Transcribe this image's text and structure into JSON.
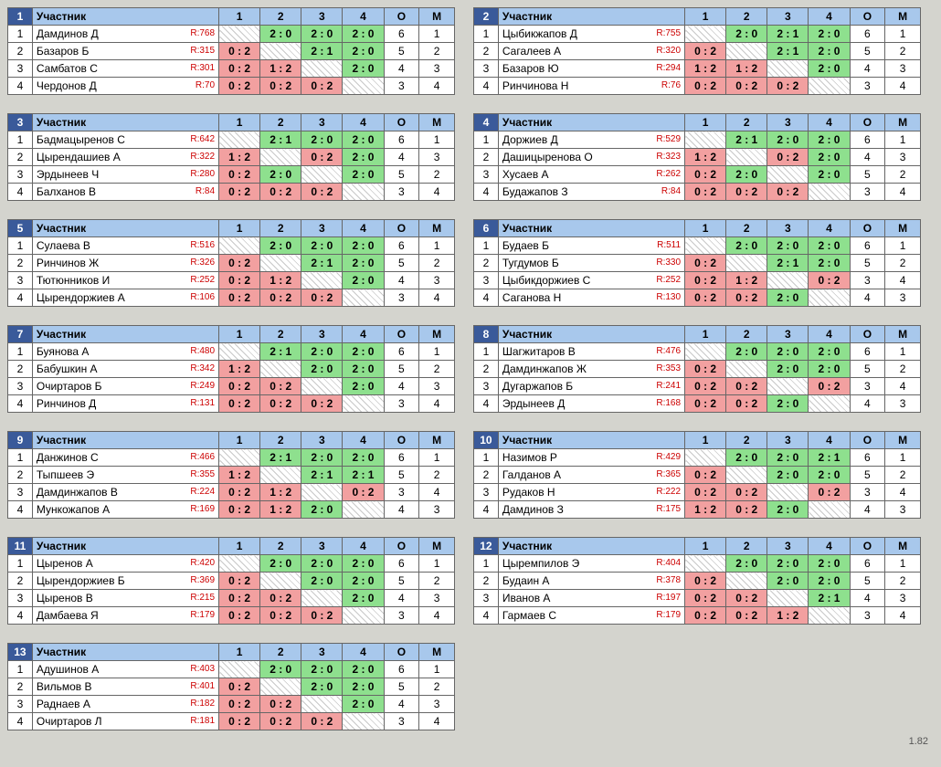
{
  "headers": {
    "player": "Участник",
    "pts": "О",
    "place": "М"
  },
  "footer_version": "1.82",
  "groups": [
    {
      "num": 1,
      "rows": [
        {
          "name": "Дамдинов Д",
          "rating": "R:768",
          "cells": [
            null,
            "2 : 0",
            "2 : 0",
            "2 : 0"
          ],
          "pts": 6,
          "place": 1
        },
        {
          "name": "Базаров Б",
          "rating": "R:315",
          "cells": [
            "0 : 2",
            null,
            "2 : 1",
            "2 : 0"
          ],
          "pts": 5,
          "place": 2
        },
        {
          "name": "Самбатов С",
          "rating": "R:301",
          "cells": [
            "0 : 2",
            "1 : 2",
            null,
            "2 : 0"
          ],
          "pts": 4,
          "place": 3
        },
        {
          "name": "Чердонов Д",
          "rating": "R:70",
          "cells": [
            "0 : 2",
            "0 : 2",
            "0 : 2",
            null
          ],
          "pts": 3,
          "place": 4
        }
      ]
    },
    {
      "num": 2,
      "rows": [
        {
          "name": "Цыбикжапов Д",
          "rating": "R:755",
          "cells": [
            null,
            "2 : 0",
            "2 : 1",
            "2 : 0"
          ],
          "pts": 6,
          "place": 1
        },
        {
          "name": "Сагалеев А",
          "rating": "R:320",
          "cells": [
            "0 : 2",
            null,
            "2 : 1",
            "2 : 0"
          ],
          "pts": 5,
          "place": 2
        },
        {
          "name": "Базаров Ю",
          "rating": "R:294",
          "cells": [
            "1 : 2",
            "1 : 2",
            null,
            "2 : 0"
          ],
          "pts": 4,
          "place": 3
        },
        {
          "name": "Ринчинова Н",
          "rating": "R:76",
          "cells": [
            "0 : 2",
            "0 : 2",
            "0 : 2",
            null
          ],
          "pts": 3,
          "place": 4
        }
      ]
    },
    {
      "num": 3,
      "rows": [
        {
          "name": "Бадмацыренов С",
          "rating": "R:642",
          "cells": [
            null,
            "2 : 1",
            "2 : 0",
            "2 : 0"
          ],
          "pts": 6,
          "place": 1
        },
        {
          "name": "Цырендашиев А",
          "rating": "R:322",
          "cells": [
            "1 : 2",
            null,
            "0 : 2",
            "2 : 0"
          ],
          "pts": 4,
          "place": 3
        },
        {
          "name": "Эрдынеев Ч",
          "rating": "R:280",
          "cells": [
            "0 : 2",
            "2 : 0",
            null,
            "2 : 0"
          ],
          "pts": 5,
          "place": 2
        },
        {
          "name": "Балханов В",
          "rating": "R:84",
          "cells": [
            "0 : 2",
            "0 : 2",
            "0 : 2",
            null
          ],
          "pts": 3,
          "place": 4
        }
      ]
    },
    {
      "num": 4,
      "rows": [
        {
          "name": "Доржиев Д",
          "rating": "R:529",
          "cells": [
            null,
            "2 : 1",
            "2 : 0",
            "2 : 0"
          ],
          "pts": 6,
          "place": 1
        },
        {
          "name": "Дашицыренова О",
          "rating": "R:323",
          "cells": [
            "1 : 2",
            null,
            "0 : 2",
            "2 : 0"
          ],
          "pts": 4,
          "place": 3
        },
        {
          "name": "Хусаев А",
          "rating": "R:262",
          "cells": [
            "0 : 2",
            "2 : 0",
            null,
            "2 : 0"
          ],
          "pts": 5,
          "place": 2
        },
        {
          "name": "Будажапов З",
          "rating": "R:84",
          "cells": [
            "0 : 2",
            "0 : 2",
            "0 : 2",
            null
          ],
          "pts": 3,
          "place": 4
        }
      ]
    },
    {
      "num": 5,
      "rows": [
        {
          "name": "Сулаева В",
          "rating": "R:516",
          "cells": [
            null,
            "2 : 0",
            "2 : 0",
            "2 : 0"
          ],
          "pts": 6,
          "place": 1
        },
        {
          "name": "Ринчинов Ж",
          "rating": "R:326",
          "cells": [
            "0 : 2",
            null,
            "2 : 1",
            "2 : 0"
          ],
          "pts": 5,
          "place": 2
        },
        {
          "name": "Тютюнников И",
          "rating": "R:252",
          "cells": [
            "0 : 2",
            "1 : 2",
            null,
            "2 : 0"
          ],
          "pts": 4,
          "place": 3
        },
        {
          "name": "Цырендоржиев А",
          "rating": "R:106",
          "cells": [
            "0 : 2",
            "0 : 2",
            "0 : 2",
            null
          ],
          "pts": 3,
          "place": 4
        }
      ]
    },
    {
      "num": 6,
      "rows": [
        {
          "name": "Будаев Б",
          "rating": "R:511",
          "cells": [
            null,
            "2 : 0",
            "2 : 0",
            "2 : 0"
          ],
          "pts": 6,
          "place": 1
        },
        {
          "name": "Тугдумов Б",
          "rating": "R:330",
          "cells": [
            "0 : 2",
            null,
            "2 : 1",
            "2 : 0"
          ],
          "pts": 5,
          "place": 2
        },
        {
          "name": "Цыбикдоржиев С",
          "rating": "R:252",
          "cells": [
            "0 : 2",
            "1 : 2",
            null,
            "0 : 2"
          ],
          "pts": 3,
          "place": 4
        },
        {
          "name": "Саганова Н",
          "rating": "R:130",
          "cells": [
            "0 : 2",
            "0 : 2",
            "2 : 0",
            null
          ],
          "pts": 4,
          "place": 3
        }
      ]
    },
    {
      "num": 7,
      "rows": [
        {
          "name": "Буянова А",
          "rating": "R:480",
          "cells": [
            null,
            "2 : 1",
            "2 : 0",
            "2 : 0"
          ],
          "pts": 6,
          "place": 1
        },
        {
          "name": "Бабушкин А",
          "rating": "R:342",
          "cells": [
            "1 : 2",
            null,
            "2 : 0",
            "2 : 0"
          ],
          "pts": 5,
          "place": 2
        },
        {
          "name": "Очиртаров Б",
          "rating": "R:249",
          "cells": [
            "0 : 2",
            "0 : 2",
            null,
            "2 : 0"
          ],
          "pts": 4,
          "place": 3
        },
        {
          "name": "Ринчинов Д",
          "rating": "R:131",
          "cells": [
            "0 : 2",
            "0 : 2",
            "0 : 2",
            null
          ],
          "pts": 3,
          "place": 4
        }
      ]
    },
    {
      "num": 8,
      "rows": [
        {
          "name": "Шагжитаров В",
          "rating": "R:476",
          "cells": [
            null,
            "2 : 0",
            "2 : 0",
            "2 : 0"
          ],
          "pts": 6,
          "place": 1
        },
        {
          "name": "Дамдинжапов Ж",
          "rating": "R:353",
          "cells": [
            "0 : 2",
            null,
            "2 : 0",
            "2 : 0"
          ],
          "pts": 5,
          "place": 2
        },
        {
          "name": "Дугаржапов Б",
          "rating": "R:241",
          "cells": [
            "0 : 2",
            "0 : 2",
            null,
            "0 : 2"
          ],
          "pts": 3,
          "place": 4
        },
        {
          "name": "Эрдынеев Д",
          "rating": "R:168",
          "cells": [
            "0 : 2",
            "0 : 2",
            "2 : 0",
            null
          ],
          "pts": 4,
          "place": 3
        }
      ]
    },
    {
      "num": 9,
      "rows": [
        {
          "name": "Данжинов С",
          "rating": "R:466",
          "cells": [
            null,
            "2 : 1",
            "2 : 0",
            "2 : 0"
          ],
          "pts": 6,
          "place": 1
        },
        {
          "name": "Тыпшеев Э",
          "rating": "R:355",
          "cells": [
            "1 : 2",
            null,
            "2 : 1",
            "2 : 1"
          ],
          "pts": 5,
          "place": 2
        },
        {
          "name": "Дамдинжапов В",
          "rating": "R:224",
          "cells": [
            "0 : 2",
            "1 : 2",
            null,
            "0 : 2"
          ],
          "pts": 3,
          "place": 4
        },
        {
          "name": "Мункожапов А",
          "rating": "R:169",
          "cells": [
            "0 : 2",
            "1 : 2",
            "2 : 0",
            null
          ],
          "pts": 4,
          "place": 3
        }
      ]
    },
    {
      "num": 10,
      "rows": [
        {
          "name": "Назимов Р",
          "rating": "R:429",
          "cells": [
            null,
            "2 : 0",
            "2 : 0",
            "2 : 1"
          ],
          "pts": 6,
          "place": 1
        },
        {
          "name": "Галданов А",
          "rating": "R:365",
          "cells": [
            "0 : 2",
            null,
            "2 : 0",
            "2 : 0"
          ],
          "pts": 5,
          "place": 2
        },
        {
          "name": "Рудаков Н",
          "rating": "R:222",
          "cells": [
            "0 : 2",
            "0 : 2",
            null,
            "0 : 2"
          ],
          "pts": 3,
          "place": 4
        },
        {
          "name": "Дамдинов З",
          "rating": "R:175",
          "cells": [
            "1 : 2",
            "0 : 2",
            "2 : 0",
            null
          ],
          "pts": 4,
          "place": 3
        }
      ]
    },
    {
      "num": 11,
      "rows": [
        {
          "name": "Цыренов А",
          "rating": "R:420",
          "cells": [
            null,
            "2 : 0",
            "2 : 0",
            "2 : 0"
          ],
          "pts": 6,
          "place": 1
        },
        {
          "name": "Цырендоржиев Б",
          "rating": "R:369",
          "cells": [
            "0 : 2",
            null,
            "2 : 0",
            "2 : 0"
          ],
          "pts": 5,
          "place": 2
        },
        {
          "name": "Цыренов В",
          "rating": "R:215",
          "cells": [
            "0 : 2",
            "0 : 2",
            null,
            "2 : 0"
          ],
          "pts": 4,
          "place": 3
        },
        {
          "name": "Дамбаева Я",
          "rating": "R:179",
          "cells": [
            "0 : 2",
            "0 : 2",
            "0 : 2",
            null
          ],
          "pts": 3,
          "place": 4
        }
      ]
    },
    {
      "num": 12,
      "rows": [
        {
          "name": "Цыремпилов Э",
          "rating": "R:404",
          "cells": [
            null,
            "2 : 0",
            "2 : 0",
            "2 : 0"
          ],
          "pts": 6,
          "place": 1
        },
        {
          "name": "Будаин А",
          "rating": "R:378",
          "cells": [
            "0 : 2",
            null,
            "2 : 0",
            "2 : 0"
          ],
          "pts": 5,
          "place": 2
        },
        {
          "name": "Иванов А",
          "rating": "R:197",
          "cells": [
            "0 : 2",
            "0 : 2",
            null,
            "2 : 1"
          ],
          "pts": 4,
          "place": 3
        },
        {
          "name": "Гармаев С",
          "rating": "R:179",
          "cells": [
            "0 : 2",
            "0 : 2",
            "1 : 2",
            null
          ],
          "pts": 3,
          "place": 4
        }
      ]
    },
    {
      "num": 13,
      "rows": [
        {
          "name": "Адушинов А",
          "rating": "R:403",
          "cells": [
            null,
            "2 : 0",
            "2 : 0",
            "2 : 0"
          ],
          "pts": 6,
          "place": 1
        },
        {
          "name": "Вильмов В",
          "rating": "R:401",
          "cells": [
            "0 : 2",
            null,
            "2 : 0",
            "2 : 0"
          ],
          "pts": 5,
          "place": 2
        },
        {
          "name": "Раднаев А",
          "rating": "R:182",
          "cells": [
            "0 : 2",
            "0 : 2",
            null,
            "2 : 0"
          ],
          "pts": 4,
          "place": 3
        },
        {
          "name": "Очиртаров Л",
          "rating": "R:181",
          "cells": [
            "0 : 2",
            "0 : 2",
            "0 : 2",
            null
          ],
          "pts": 3,
          "place": 4
        }
      ]
    }
  ]
}
